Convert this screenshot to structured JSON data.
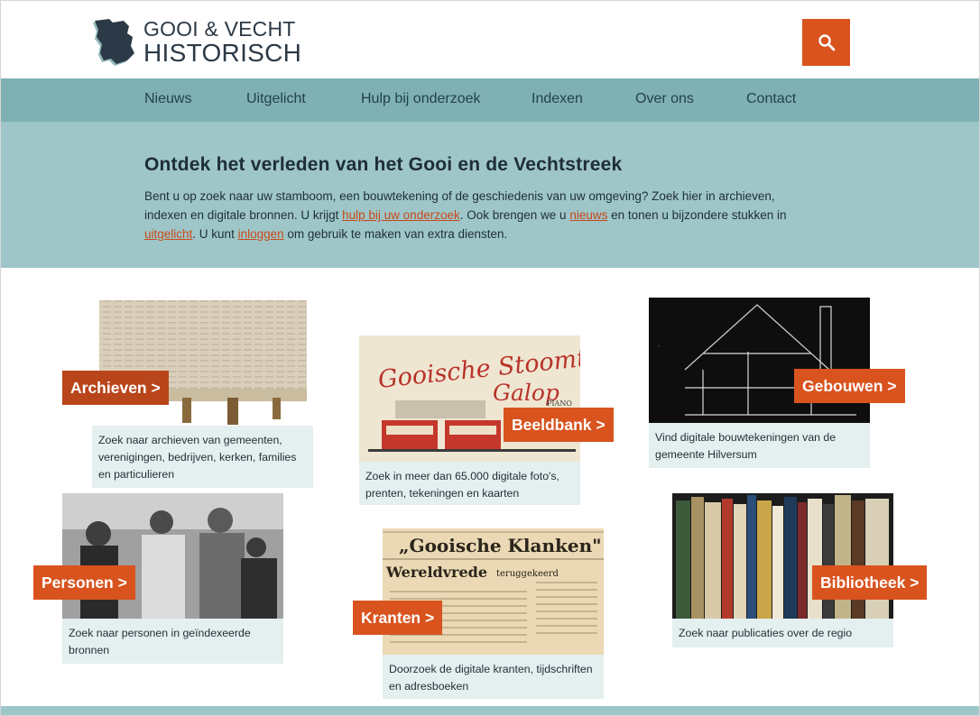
{
  "logo": {
    "line1": "GOOI & VECHT",
    "line2": "HISTORISCH"
  },
  "search": {
    "icon": "search-icon"
  },
  "nav": {
    "items": [
      "Nieuws",
      "Uitgelicht",
      "Hulp bij onderzoek",
      "Indexen",
      "Over ons",
      "Contact"
    ]
  },
  "intro": {
    "title": "Ontdek het verleden van het Gooi en de Vechtstreek",
    "text_1": "Bent u op zoek naar uw stamboom, een bouwtekening of de geschiedenis van uw omgeving? Zoek hier in archieven, indexen en digitale bronnen. U krijgt ",
    "link_1": "hulp bij uw onderzoek",
    "text_2": ". Ook brengen we u ",
    "link_2": "nieuws",
    "text_3": " en tonen u bijzondere stukken in ",
    "link_3": "uitgelicht",
    "text_4": ". U kunt ",
    "link_4": "inloggen",
    "text_5": " om gebruik te maken van extra diensten."
  },
  "cards": {
    "archieven": {
      "label": "Archieven >",
      "caption": "Zoek naar archieven van gemeenten, verenigingen, bedrijven, kerken, families en particulieren"
    },
    "beeldbank": {
      "label": "Beeldbank >",
      "caption": "Zoek in meer dan 65.000 digitale foto's, prenten, tekeningen en kaarten",
      "image_text_1": "Gooische Stoomtram",
      "image_text_2": "Galop",
      "image_text_3": "PIANO"
    },
    "gebouwen": {
      "label": "Gebouwen >",
      "caption": "Vind digitale bouwtekeningen van de gemeente Hilversum"
    },
    "personen": {
      "label": "Personen >",
      "caption": "Zoek naar personen in geïndexeerde bronnen"
    },
    "kranten": {
      "label": "Kranten >",
      "caption": "Doorzoek de digitale kranten, tijdschriften en adresboeken",
      "image_text_1": "„Gooische Klanken\"",
      "image_text_2": "Wereldvrede",
      "image_text_3": "teruggekeerd"
    },
    "bibliotheek": {
      "label": "Bibliotheek >",
      "caption": "Zoek naar publicaties over de regio"
    }
  },
  "colors": {
    "accent": "#d9531e",
    "accent_dark": "#b9451a",
    "nav": "#7fb0b4",
    "intro": "#9ec6c8",
    "caption": "#e4efef"
  }
}
